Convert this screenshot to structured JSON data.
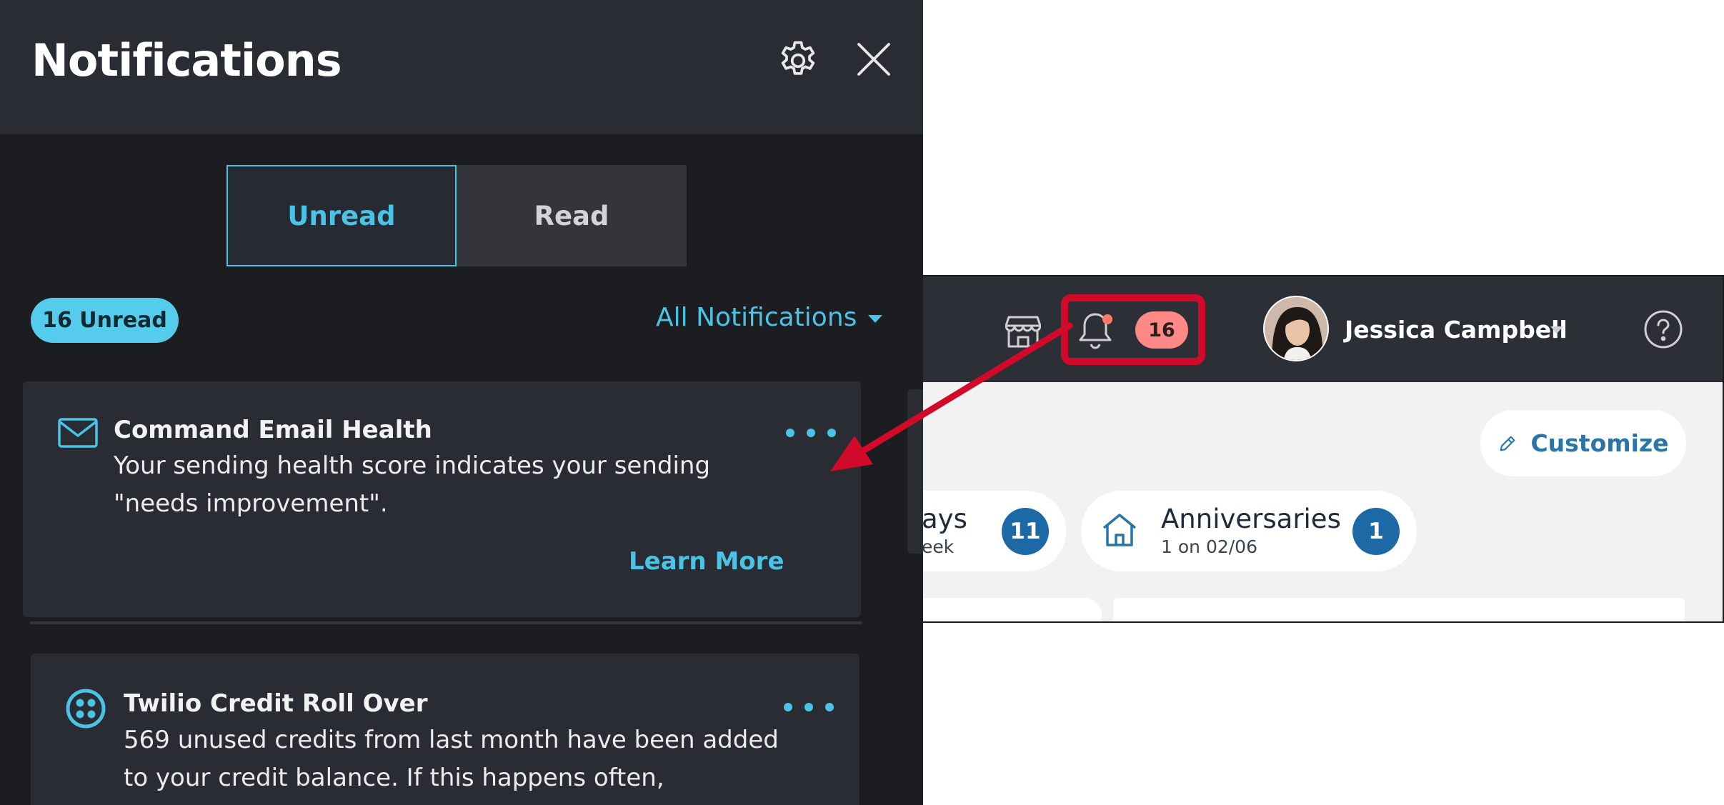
{
  "notifications_panel": {
    "title": "Notifications",
    "icons": {
      "settings": "gear-icon",
      "close": "close-icon"
    },
    "tabs": [
      {
        "label": "Unread",
        "active": true
      },
      {
        "label": "Read",
        "active": false
      }
    ],
    "unread_badge": "16 Unread",
    "filter_label": "All Notifications",
    "items": [
      {
        "icon": "envelope-icon",
        "title": "Command Email Health",
        "body": "Your sending health score indicates your sending \"needs improvement\".",
        "action_label": "Learn More"
      },
      {
        "icon": "twilio-icon",
        "title": "Twilio Credit Roll Over",
        "body": "569 unused credits from last month have been added to your credit balance. If this happens often,"
      }
    ]
  },
  "dashboard": {
    "notification_count": "16",
    "user_name": "Jessica Campbell",
    "customize_label": "Customize",
    "pills": [
      {
        "title": "ays",
        "subtitle": "eek",
        "count": "11"
      },
      {
        "title": "Anniversaries",
        "subtitle": "1 on 02/06",
        "count": "1"
      }
    ]
  },
  "colors": {
    "accent": "#4bc3e6",
    "panel_bg": "#1c1d21",
    "header_bg": "#2a2c33",
    "highlight": "#d10a2a",
    "badge_pink": "#ff8a85",
    "count_blue": "#1d69a5"
  }
}
